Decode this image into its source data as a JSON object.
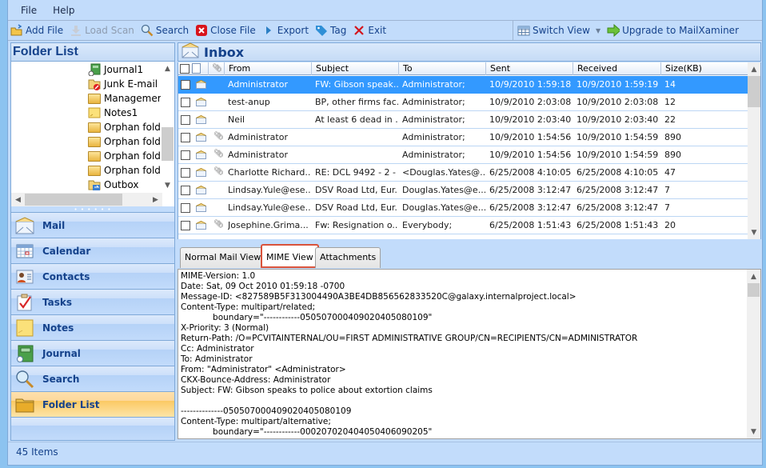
{
  "menu": [
    "File",
    "Help"
  ],
  "toolbar": {
    "add_file": "Add File",
    "load_scan": "Load Scan",
    "search": "Search",
    "close_file": "Close File",
    "export": "Export",
    "tag": "Tag",
    "exit": "Exit",
    "switch_view": "Switch View",
    "upgrade": "Upgrade to MailXaminer"
  },
  "folder_list": {
    "title": "Folder List",
    "items": [
      {
        "label": "Journal1",
        "icon": "journal-icon"
      },
      {
        "label": "Junk E-mail",
        "icon": "junk-folder-icon"
      },
      {
        "label": "Managemer",
        "icon": "folder-icon"
      },
      {
        "label": "Notes1",
        "icon": "notes-icon"
      },
      {
        "label": "Orphan fold",
        "icon": "folder-icon"
      },
      {
        "label": "Orphan fold",
        "icon": "folder-icon"
      },
      {
        "label": "Orphan fold",
        "icon": "folder-icon"
      },
      {
        "label": "Orphan fold",
        "icon": "folder-icon"
      },
      {
        "label": "Outbox",
        "icon": "outbox-icon"
      }
    ]
  },
  "nav": [
    {
      "label": "Mail",
      "icon": "mail-icon",
      "active": false
    },
    {
      "label": "Calendar",
      "icon": "calendar-icon",
      "active": false
    },
    {
      "label": "Contacts",
      "icon": "contacts-icon",
      "active": false
    },
    {
      "label": "Tasks",
      "icon": "tasks-icon",
      "active": false
    },
    {
      "label": "Notes",
      "icon": "notes-icon",
      "active": false
    },
    {
      "label": "Journal",
      "icon": "journal-icon",
      "active": false
    },
    {
      "label": "Search",
      "icon": "search-icon",
      "active": false
    },
    {
      "label": "Folder List",
      "icon": "folder-icon",
      "active": true
    }
  ],
  "status": {
    "items_count": "45 Items"
  },
  "inbox": {
    "title": "Inbox",
    "columns": [
      "From",
      "Subject",
      "To",
      "Sent",
      "Received",
      "Size(KB)"
    ],
    "rows": [
      {
        "attach": false,
        "from": "Administrator",
        "subject": "FW: Gibson speak...",
        "to": "Administrator;",
        "sent": "10/9/2010 1:59:18 ...",
        "received": "10/9/2010 1:59:19 ...",
        "size": "14",
        "selected": true
      },
      {
        "attach": false,
        "from": "test-anup",
        "subject": "BP, other firms fac...",
        "to": "Administrator;",
        "sent": "10/9/2010 2:03:08 ...",
        "received": "10/9/2010 2:03:08 ...",
        "size": "12",
        "selected": false
      },
      {
        "attach": false,
        "from": "Neil",
        "subject": "At least 6 dead in ...",
        "to": "Administrator;",
        "sent": "10/9/2010 2:03:40 ...",
        "received": "10/9/2010 2:03:40 ...",
        "size": "22",
        "selected": false
      },
      {
        "attach": true,
        "from": "Administrator",
        "subject": "",
        "to": "Administrator;",
        "sent": "10/9/2010 1:54:56 ...",
        "received": "10/9/2010 1:54:59 ...",
        "size": "890",
        "selected": false
      },
      {
        "attach": true,
        "from": "Administrator",
        "subject": "",
        "to": "Administrator;",
        "sent": "10/9/2010 1:54:56 ...",
        "received": "10/9/2010 1:54:59 ...",
        "size": "890",
        "selected": false
      },
      {
        "attach": true,
        "from": "Charlotte Richard...",
        "subject": "RE: DCL 9492 - 2 - ...",
        "to": "<Douglas.Yates@...",
        "sent": "6/25/2008 4:10:05 ...",
        "received": "6/25/2008 4:10:05 ...",
        "size": "47",
        "selected": false
      },
      {
        "attach": false,
        "from": "Lindsay.Yule@ese...",
        "subject": "DSV Road Ltd, Eur...",
        "to": "Douglas.Yates@e...",
        "sent": "6/25/2008 3:12:47 ...",
        "received": "6/25/2008 3:12:47 ...",
        "size": "7",
        "selected": false
      },
      {
        "attach": false,
        "from": "Lindsay.Yule@ese...",
        "subject": "DSV Road Ltd, Eur...",
        "to": "Douglas.Yates@e...",
        "sent": "6/25/2008 3:12:47 ...",
        "received": "6/25/2008 3:12:47 ...",
        "size": "7",
        "selected": false
      },
      {
        "attach": true,
        "from": "Josephine.Grima...",
        "subject": "Fw: Resignation o...",
        "to": "Everybody;",
        "sent": "6/25/2008 1:51:43 ...",
        "received": "6/25/2008 1:51:43 ...",
        "size": "20",
        "selected": false
      }
    ]
  },
  "tabs": [
    {
      "label": "Normal Mail View",
      "active": false
    },
    {
      "label": "MIME View",
      "active": true
    },
    {
      "label": "Attachments",
      "active": false
    }
  ],
  "mime_lines": [
    "MIME-Version: 1.0",
    "Date: Sat, 09 Oct 2010 01:59:18 -0700",
    "Message-ID: <827589B5F313004490A3BE4DB856562833520C@galaxy.internalproject.local>",
    "Content-Type: multipart/related;",
    "            boundary=\"------------050507000409020405080109\"",
    "X-Priority: 3 (Normal)",
    "Return-Path: /O=PCVITAINTERNAL/OU=FIRST ADMINISTRATIVE GROUP/CN=RECIPIENTS/CN=ADMINISTRATOR",
    "Cc: Administrator",
    "To: Administrator",
    "From: \"Administrator\" <Administrator>",
    "CKX-Bounce-Address: Administrator",
    "Subject: FW: Gibson speaks to police about extortion claims",
    "",
    "--------------050507000409020405080109",
    "Content-Type: multipart/alternative;",
    "            boundary=\"------------000207020404050406090205\""
  ]
}
